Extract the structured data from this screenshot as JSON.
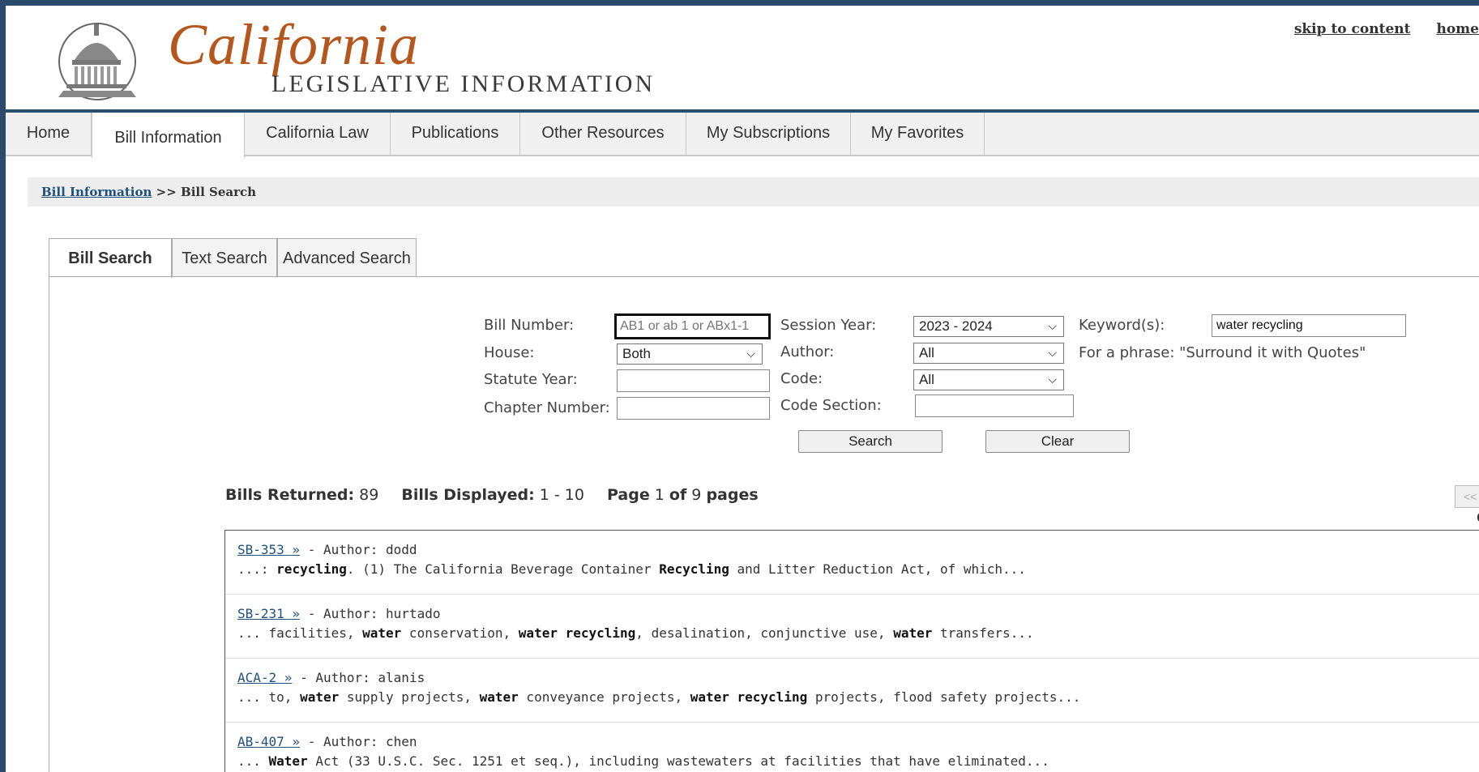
{
  "header": {
    "logo_script": "California",
    "logo_subtitle": "LEGISLATIVE INFORMATION",
    "skip_link": "skip to content",
    "home_link": "home"
  },
  "nav": {
    "items": [
      {
        "label": "Home"
      },
      {
        "label": "Bill Information"
      },
      {
        "label": "California Law"
      },
      {
        "label": "Publications"
      },
      {
        "label": "Other Resources"
      },
      {
        "label": "My Subscriptions"
      },
      {
        "label": "My Favorites"
      }
    ],
    "active": "Bill Information"
  },
  "breadcrumb": {
    "link": "Bill Information",
    "separator": ">>",
    "current": "Bill Search"
  },
  "tabs": {
    "items": [
      {
        "label": "Bill Search"
      },
      {
        "label": "Text Search"
      },
      {
        "label": "Advanced Search"
      }
    ],
    "active": "Bill Search"
  },
  "form": {
    "bill_number_label": "Bill Number:",
    "bill_number_placeholder": "AB1 or ab 1 or ABx1-1",
    "house_label": "House:",
    "house_value": "Both",
    "statute_year_label": "Statute Year:",
    "chapter_number_label": "Chapter Number:",
    "session_year_label": "Session Year:",
    "session_year_value": "2023 - 2024",
    "author_label": "Author:",
    "author_value": "All",
    "code_label": "Code:",
    "code_value": "All",
    "code_section_label": "Code Section:",
    "keywords_label": "Keyword(s):",
    "keywords_value": "water recycling",
    "phrase_hint": "For a phrase: \"Surround it with Quotes\"",
    "search_button": "Search",
    "clear_button": "Clear"
  },
  "summary": {
    "bills_returned_label": "Bills Returned:",
    "bills_returned": "89",
    "bills_displayed_label": "Bills Displayed:",
    "bills_displayed": "1 - 10",
    "page_label": "Page",
    "page": "1",
    "of_label": "of",
    "total_pages": "9",
    "pages_label": "pages",
    "pager_prev": "<<",
    "pager_go": "G"
  },
  "results": [
    {
      "bill": "SB-353 »",
      "author_text": "- Author: dodd",
      "snippet": [
        {
          "t": "...: ",
          "b": false
        },
        {
          "t": "recycling",
          "b": true
        },
        {
          "t": ". (1) The California Beverage Container ",
          "b": false
        },
        {
          "t": "Recycling",
          "b": true
        },
        {
          "t": " and Litter Reduction Act, of which...",
          "b": false
        }
      ]
    },
    {
      "bill": "SB-231 »",
      "author_text": "- Author: hurtado",
      "snippet": [
        {
          "t": "... facilities, ",
          "b": false
        },
        {
          "t": "water",
          "b": true
        },
        {
          "t": " conservation, ",
          "b": false
        },
        {
          "t": "water recycling",
          "b": true
        },
        {
          "t": ", desalination, conjunctive use, ",
          "b": false
        },
        {
          "t": "water",
          "b": true
        },
        {
          "t": " transfers...",
          "b": false
        }
      ]
    },
    {
      "bill": "ACA-2 »",
      "author_text": "- Author: alanis",
      "snippet": [
        {
          "t": "... to, ",
          "b": false
        },
        {
          "t": "water",
          "b": true
        },
        {
          "t": " supply projects, ",
          "b": false
        },
        {
          "t": "water",
          "b": true
        },
        {
          "t": " conveyance projects, ",
          "b": false
        },
        {
          "t": "water recycling",
          "b": true
        },
        {
          "t": " projects, flood safety projects...",
          "b": false
        }
      ]
    },
    {
      "bill": "AB-407 »",
      "author_text": "- Author: chen",
      "snippet": [
        {
          "t": "... ",
          "b": false
        },
        {
          "t": "Water",
          "b": true
        },
        {
          "t": " Act (33 U.S.C. Sec. 1251 et seq.), including wastewaters at facilities that have eliminated...",
          "b": false
        }
      ]
    }
  ],
  "colors": {
    "brand": "#b5561d",
    "header_rule": "#294f6f",
    "link": "#1e4f7d"
  }
}
